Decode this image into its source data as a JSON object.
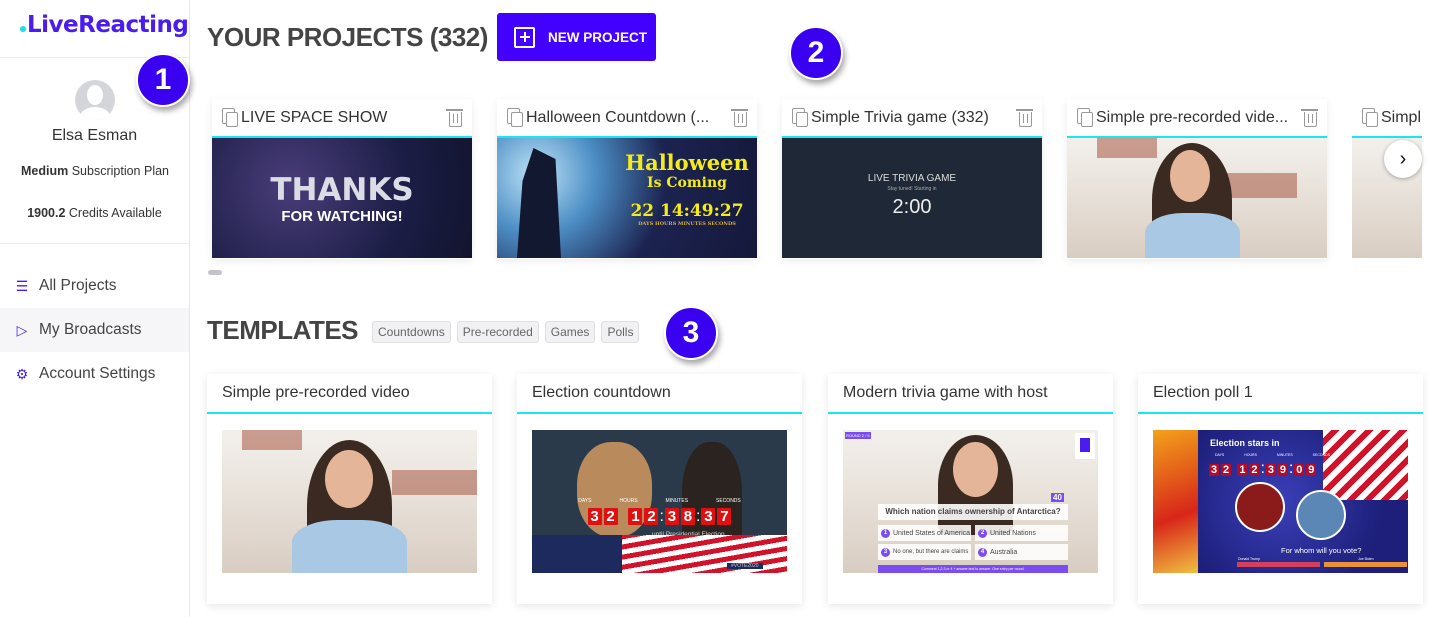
{
  "brand": {
    "name": "LiveReacting",
    "accent": "#4200ff",
    "highlight": "#18e8ee"
  },
  "user": {
    "name": "Elsa Esman",
    "plan_bold": "Medium",
    "plan_rest": "Subscription Plan",
    "credits_bold": "1900.2",
    "credits_rest": "Credits Available"
  },
  "nav": [
    {
      "label": "All Projects",
      "icon": "menu-icon"
    },
    {
      "label": "My Broadcasts",
      "icon": "play-icon",
      "active": true
    },
    {
      "label": "Account Settings",
      "icon": "gear-icon"
    }
  ],
  "callouts": [
    "1",
    "2",
    "3"
  ],
  "projects": {
    "title": "YOUR PROJECTS (332)",
    "new_label": "NEW PROJECT",
    "items": [
      {
        "title": "LIVE SPACE SHOW",
        "thumb": {
          "line1": "THANKS",
          "line2": "FOR WATCHING!"
        }
      },
      {
        "title": "Halloween Countdown (...",
        "thumb": {
          "line1": "Halloween",
          "line2": "Is Coming",
          "timer": "22 14:49:27",
          "units": "DAYS   HOURS   MINUTES   SECONDS"
        }
      },
      {
        "title": "Simple Trivia game (332)",
        "thumb": {
          "line1": "LIVE TRIVIA GAME",
          "line2": "Stay tuned! Starting in",
          "timer": "2:00"
        }
      },
      {
        "title": "Simple pre-recorded vide...",
        "thumb": {}
      },
      {
        "title": "Simpl",
        "thumb": {}
      }
    ]
  },
  "templates": {
    "title": "TEMPLATES",
    "filters": [
      "Countdowns",
      "Pre-recorded",
      "Games",
      "Polls"
    ],
    "items": [
      {
        "title": "Simple pre-recorded video"
      },
      {
        "title": "Election countdown",
        "thumb": {
          "units": [
            "DAYS",
            "HOURS",
            "MINUTES",
            "SECONDS"
          ],
          "digits": [
            "3",
            "2",
            "1",
            "2",
            "3",
            "8",
            "3",
            "7"
          ],
          "caption": "until Presidential Election",
          "tag": "#VOTE2020"
        }
      },
      {
        "title": "Modern trivia game with host",
        "thumb": {
          "round": "ROUND 2 / 5",
          "score": "40",
          "question": "Which nation claims ownership of Antarctica?",
          "answers": [
            "United States of America",
            "United Nations",
            "No one, but there are claims",
            "Australia"
          ],
          "footer": "Comment 1,2,3 or 4 + answer text to answer. One entry per round."
        }
      },
      {
        "title": "Election poll 1",
        "thumb": {
          "heading": "Election stars in",
          "units": [
            "DAYS",
            "HOURS",
            "MINUTES",
            "SECONDS"
          ],
          "digits": [
            "3",
            "2",
            "1",
            "2",
            "3",
            "9",
            "0",
            "9"
          ],
          "question": "For whom will you vote?",
          "candidates": [
            "Donald Trump",
            "Joe Biden"
          ]
        }
      }
    ]
  }
}
